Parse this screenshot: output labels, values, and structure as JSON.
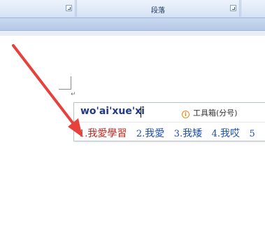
{
  "ribbon": {
    "groups": [
      {
        "label": ""
      },
      {
        "label": "段落"
      },
      {
        "label": ""
      }
    ]
  },
  "document": {
    "paragraph_mark": "↵"
  },
  "ime": {
    "composition": "wo'ai'xue'xi",
    "toolbox_label": "工具箱(分号)",
    "info_icon_glyph": "i",
    "candidates": [
      {
        "index": "1.",
        "text": "我愛學習"
      },
      {
        "index": "2.",
        "text": "我愛"
      },
      {
        "index": "3.",
        "text": "我矮"
      },
      {
        "index": "4.",
        "text": "我哎"
      },
      {
        "index": "5",
        "text": ""
      }
    ],
    "selected_color": "#c0281f",
    "candidate_color": "#1f4fae"
  },
  "annotation": {
    "arrow_color": "#e8413c"
  }
}
